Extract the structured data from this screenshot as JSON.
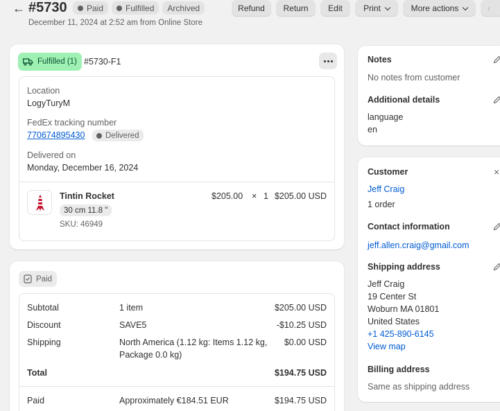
{
  "header": {
    "order_number": "#5730",
    "badges": [
      {
        "label": "Paid",
        "dot": true
      },
      {
        "label": "Fulfilled",
        "dot": true
      },
      {
        "label": "Archived",
        "dot": false
      }
    ],
    "subtitle": "December 11, 2024 at 2:52 am from Online Store"
  },
  "toolbar": {
    "refund": "Refund",
    "return": "Return",
    "edit": "Edit",
    "print": "Print",
    "more_actions": "More actions",
    "prev": "‹"
  },
  "fulfillment": {
    "status_label": "Fulfilled (1)",
    "fulfillment_id": "#5730-F1",
    "location_label": "Location",
    "location_value": "LogyTuryM",
    "tracking_label": "FedEx tracking number",
    "tracking_number": "770674895430",
    "tracking_status": "Delivered",
    "delivered_label": "Delivered on",
    "delivered_value": "Monday, December 16, 2024",
    "item": {
      "name": "Tintin Rocket",
      "variant": "30 cm 11.8 \"",
      "sku": "SKU: 46949",
      "price": "$205.00",
      "times": "×",
      "qty": "1",
      "total": "$205.00 USD"
    }
  },
  "payment": {
    "status_label": "Paid",
    "rows": [
      {
        "label": "Subtotal",
        "detail": "1 item",
        "amount": "$205.00 USD"
      },
      {
        "label": "Discount",
        "detail": "SAVE5",
        "amount": "-$10.25 USD"
      },
      {
        "label": "Shipping",
        "detail_line1": "North America (1.12 kg: Items 1.12 kg,",
        "detail_line2": "Package 0.0 kg)",
        "amount": "$0.00 USD"
      },
      {
        "label": "Total",
        "detail": "",
        "amount": "$194.75 USD"
      },
      {
        "label": "Paid",
        "detail": "Approximately €184.51 EUR",
        "amount": "$194.75 USD"
      }
    ]
  },
  "notes": {
    "title": "Notes",
    "empty_text": "No notes from customer",
    "additional_title": "Additional details",
    "language_label": "language",
    "language_value": "en"
  },
  "customer": {
    "title": "Customer",
    "name": "Jeff Craig",
    "orders": "1 order",
    "contact_title": "Contact information",
    "email": "jeff.allen.craig@gmail.com",
    "shipping_title": "Shipping address",
    "address": [
      "Jeff Craig",
      "19 Center St",
      "Woburn MA 01801",
      "United States"
    ],
    "phone": "+1 425-890-6145",
    "view_map": "View map",
    "billing_title": "Billing address",
    "billing_value": "Same as shipping address"
  }
}
